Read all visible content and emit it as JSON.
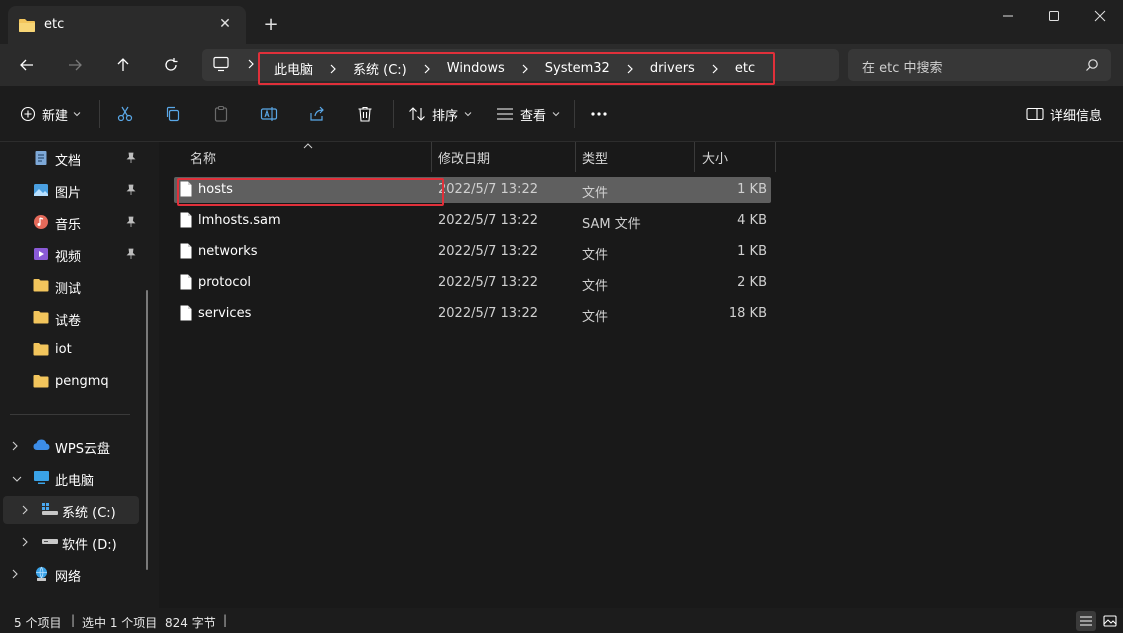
{
  "window": {
    "tab_title": "etc",
    "new_tab_symbol": "+",
    "close_tab_symbol": "✕"
  },
  "address": {
    "crumbs": [
      "此电脑",
      "系统 (C:)",
      "Windows",
      "System32",
      "drivers",
      "etc"
    ]
  },
  "search": {
    "placeholder": "在 etc 中搜索"
  },
  "toolbar": {
    "new_label": "新建",
    "sort_label": "排序",
    "view_label": "查看",
    "details_label": "详细信息"
  },
  "sidebar": {
    "quick_access": [
      {
        "label": "文档",
        "icon": "document-icon",
        "pinned": true
      },
      {
        "label": "图片",
        "icon": "picture-icon",
        "pinned": true
      },
      {
        "label": "音乐",
        "icon": "music-icon",
        "pinned": true
      },
      {
        "label": "视频",
        "icon": "video-icon",
        "pinned": true
      },
      {
        "label": "测试",
        "icon": "folder-icon",
        "pinned": false
      },
      {
        "label": "试卷",
        "icon": "folder-icon",
        "pinned": false
      },
      {
        "label": "iot",
        "icon": "folder-icon",
        "pinned": false
      },
      {
        "label": "pengmq",
        "icon": "folder-icon",
        "pinned": false
      }
    ],
    "tree": [
      {
        "label": "WPS云盘",
        "icon": "cloud-icon",
        "expanded": false
      },
      {
        "label": "此电脑",
        "icon": "computer-icon",
        "expanded": true
      },
      {
        "label": "系统 (C:)",
        "icon": "drive-c-icon",
        "expanded": false,
        "selected": true
      },
      {
        "label": "软件 (D:)",
        "icon": "drive-d-icon",
        "expanded": false
      },
      {
        "label": "网络",
        "icon": "network-icon",
        "expanded": false
      }
    ]
  },
  "columns": {
    "name": "名称",
    "modified": "修改日期",
    "type": "类型",
    "size": "大小"
  },
  "files": [
    {
      "name": "hosts",
      "modified": "2022/5/7 13:22",
      "type": "文件",
      "size": "1 KB",
      "selected": true
    },
    {
      "name": "lmhosts.sam",
      "modified": "2022/5/7 13:22",
      "type": "SAM 文件",
      "size": "4 KB"
    },
    {
      "name": "networks",
      "modified": "2022/5/7 13:22",
      "type": "文件",
      "size": "1 KB"
    },
    {
      "name": "protocol",
      "modified": "2022/5/7 13:22",
      "type": "文件",
      "size": "2 KB"
    },
    {
      "name": "services",
      "modified": "2022/5/7 13:22",
      "type": "文件",
      "size": "18 KB"
    }
  ],
  "status": {
    "item_count": "5 个项目",
    "selection": "选中 1 个项目",
    "selection_size": "824 字节"
  },
  "colors": {
    "accent_highlight": "#e0303a",
    "selected_row": "#5f5f5f",
    "folder": "#f2c55c"
  }
}
